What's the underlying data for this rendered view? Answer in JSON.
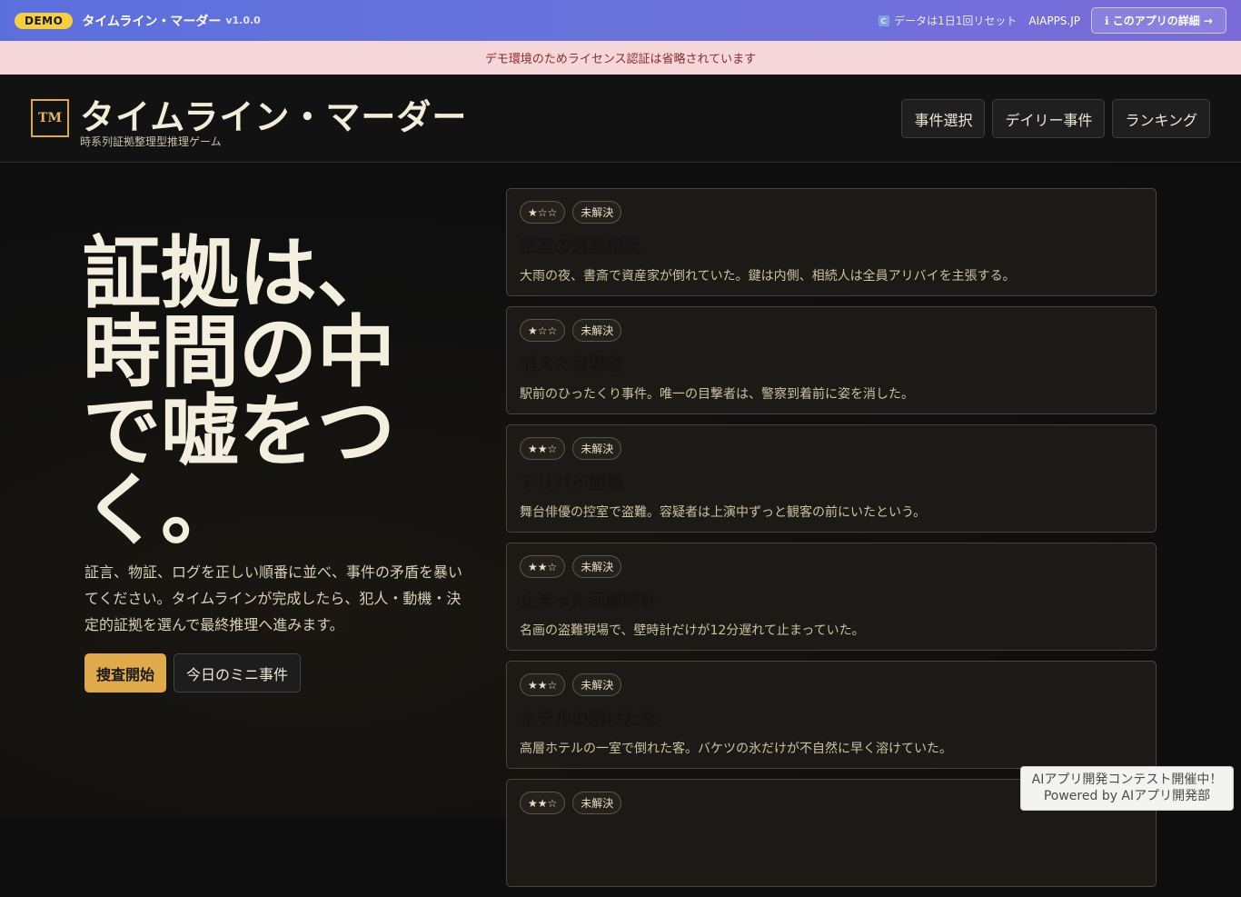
{
  "demo_bar": {
    "badge": "DEMO",
    "title": "タイムライン・マーダー",
    "version": "v1.0.0",
    "reset_note": "データは1日1回リセット",
    "site": "AIAPPS.JP",
    "details_button": "ℹ︎ このアプリの詳細 →"
  },
  "notice": "デモ環境のためライセンス認証は省略されています",
  "header": {
    "logo": "TM",
    "title": "タイムライン・マーダー",
    "subtitle": "時系列証拠整理型推理ゲーム",
    "nav": [
      "事件選択",
      "デイリー事件",
      "ランキング"
    ]
  },
  "hero": {
    "title": "証拠は、時間の中で嘘をつく。",
    "description": "証言、物証、ログを正しい順番に並べ、事件の矛盾を暴いてください。タイムラインが完成したら、犯人・動機・決定的証拠を選んで最終推理へ進みます。",
    "primary_button": "捜査開始",
    "secondary_button": "今日のミニ事件"
  },
  "cases": [
    {
      "difficulty": "★☆☆",
      "status": "未解決",
      "title": "密室の遺産相続",
      "description": "大雨の夜、書斎で資産家が倒れていた。鍵は内側、相続人は全員アリバイを主張する。"
    },
    {
      "difficulty": "★☆☆",
      "status": "未解決",
      "title": "消えた目撃者",
      "description": "駅前のひったくり事件。唯一の目撃者は、警察到着前に姿を消した。"
    },
    {
      "difficulty": "★★☆",
      "status": "未解決",
      "title": "アリバイ崩壊",
      "description": "舞台俳優の控室で盗難。容疑者は上演中ずっと観客の前にいたという。"
    },
    {
      "difficulty": "★★☆",
      "status": "未解決",
      "title": "止まった画廊時計",
      "description": "名画の盗難現場で、壁時計だけが12分遅れて止まっていた。"
    },
    {
      "difficulty": "★★☆",
      "status": "未解決",
      "title": "ホテルの溶けた氷",
      "description": "高層ホテルの一室で倒れた客。バケツの氷だけが不自然に早く溶けていた。"
    },
    {
      "difficulty": "★★☆",
      "status": "未解決",
      "title": "",
      "description": ""
    }
  ],
  "contest": {
    "line1": "AIアプリ開発コンテスト開催中！",
    "line2": "Powered by AIアプリ開発部"
  }
}
